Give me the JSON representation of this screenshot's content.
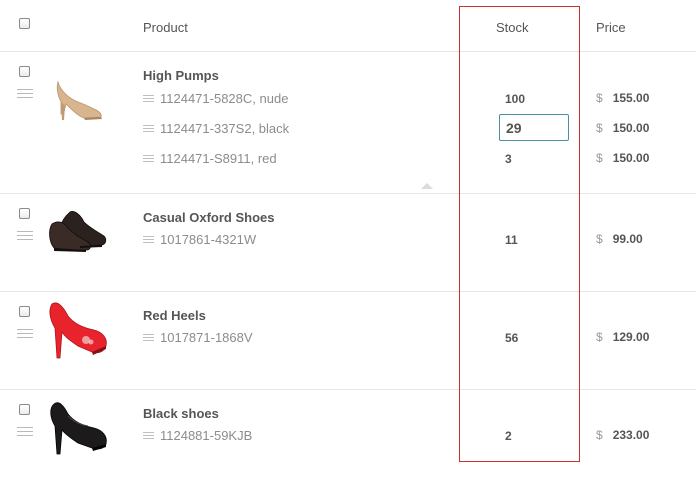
{
  "header": {
    "product_label": "Product",
    "stock_label": "Stock",
    "price_label": "Price"
  },
  "products": [
    {
      "name": "High Pumps",
      "icon": "nude-pump-shoe-icon",
      "variants": [
        {
          "sku": "1124471-5828C, nude",
          "stock": "100",
          "currency": "$",
          "price": "155.00"
        },
        {
          "sku": "1124471-337S2, black",
          "stock": "29",
          "currency": "$",
          "price": "150.00"
        },
        {
          "sku": "1124471-S8911, red",
          "stock": "3",
          "currency": "$",
          "price": "150.00"
        }
      ]
    },
    {
      "name": "Casual Oxford Shoes",
      "icon": "oxford-shoe-icon",
      "variants": [
        {
          "sku": "1017861-4321W",
          "stock": "11",
          "currency": "$",
          "price": "99.00"
        }
      ]
    },
    {
      "name": "Red Heels",
      "icon": "red-heel-shoe-icon",
      "variants": [
        {
          "sku": "1017871-1868V",
          "stock": "56",
          "currency": "$",
          "price": "129.00"
        }
      ]
    },
    {
      "name": "Black shoes",
      "icon": "black-heel-shoe-icon",
      "variants": [
        {
          "sku": "1124881-59KJB",
          "stock": "2",
          "currency": "$",
          "price": "233.00"
        }
      ]
    }
  ],
  "colors": {
    "highlight": "#c9312f",
    "input_focus_border": "#4a90a4",
    "divider": "#e6e6e6"
  }
}
